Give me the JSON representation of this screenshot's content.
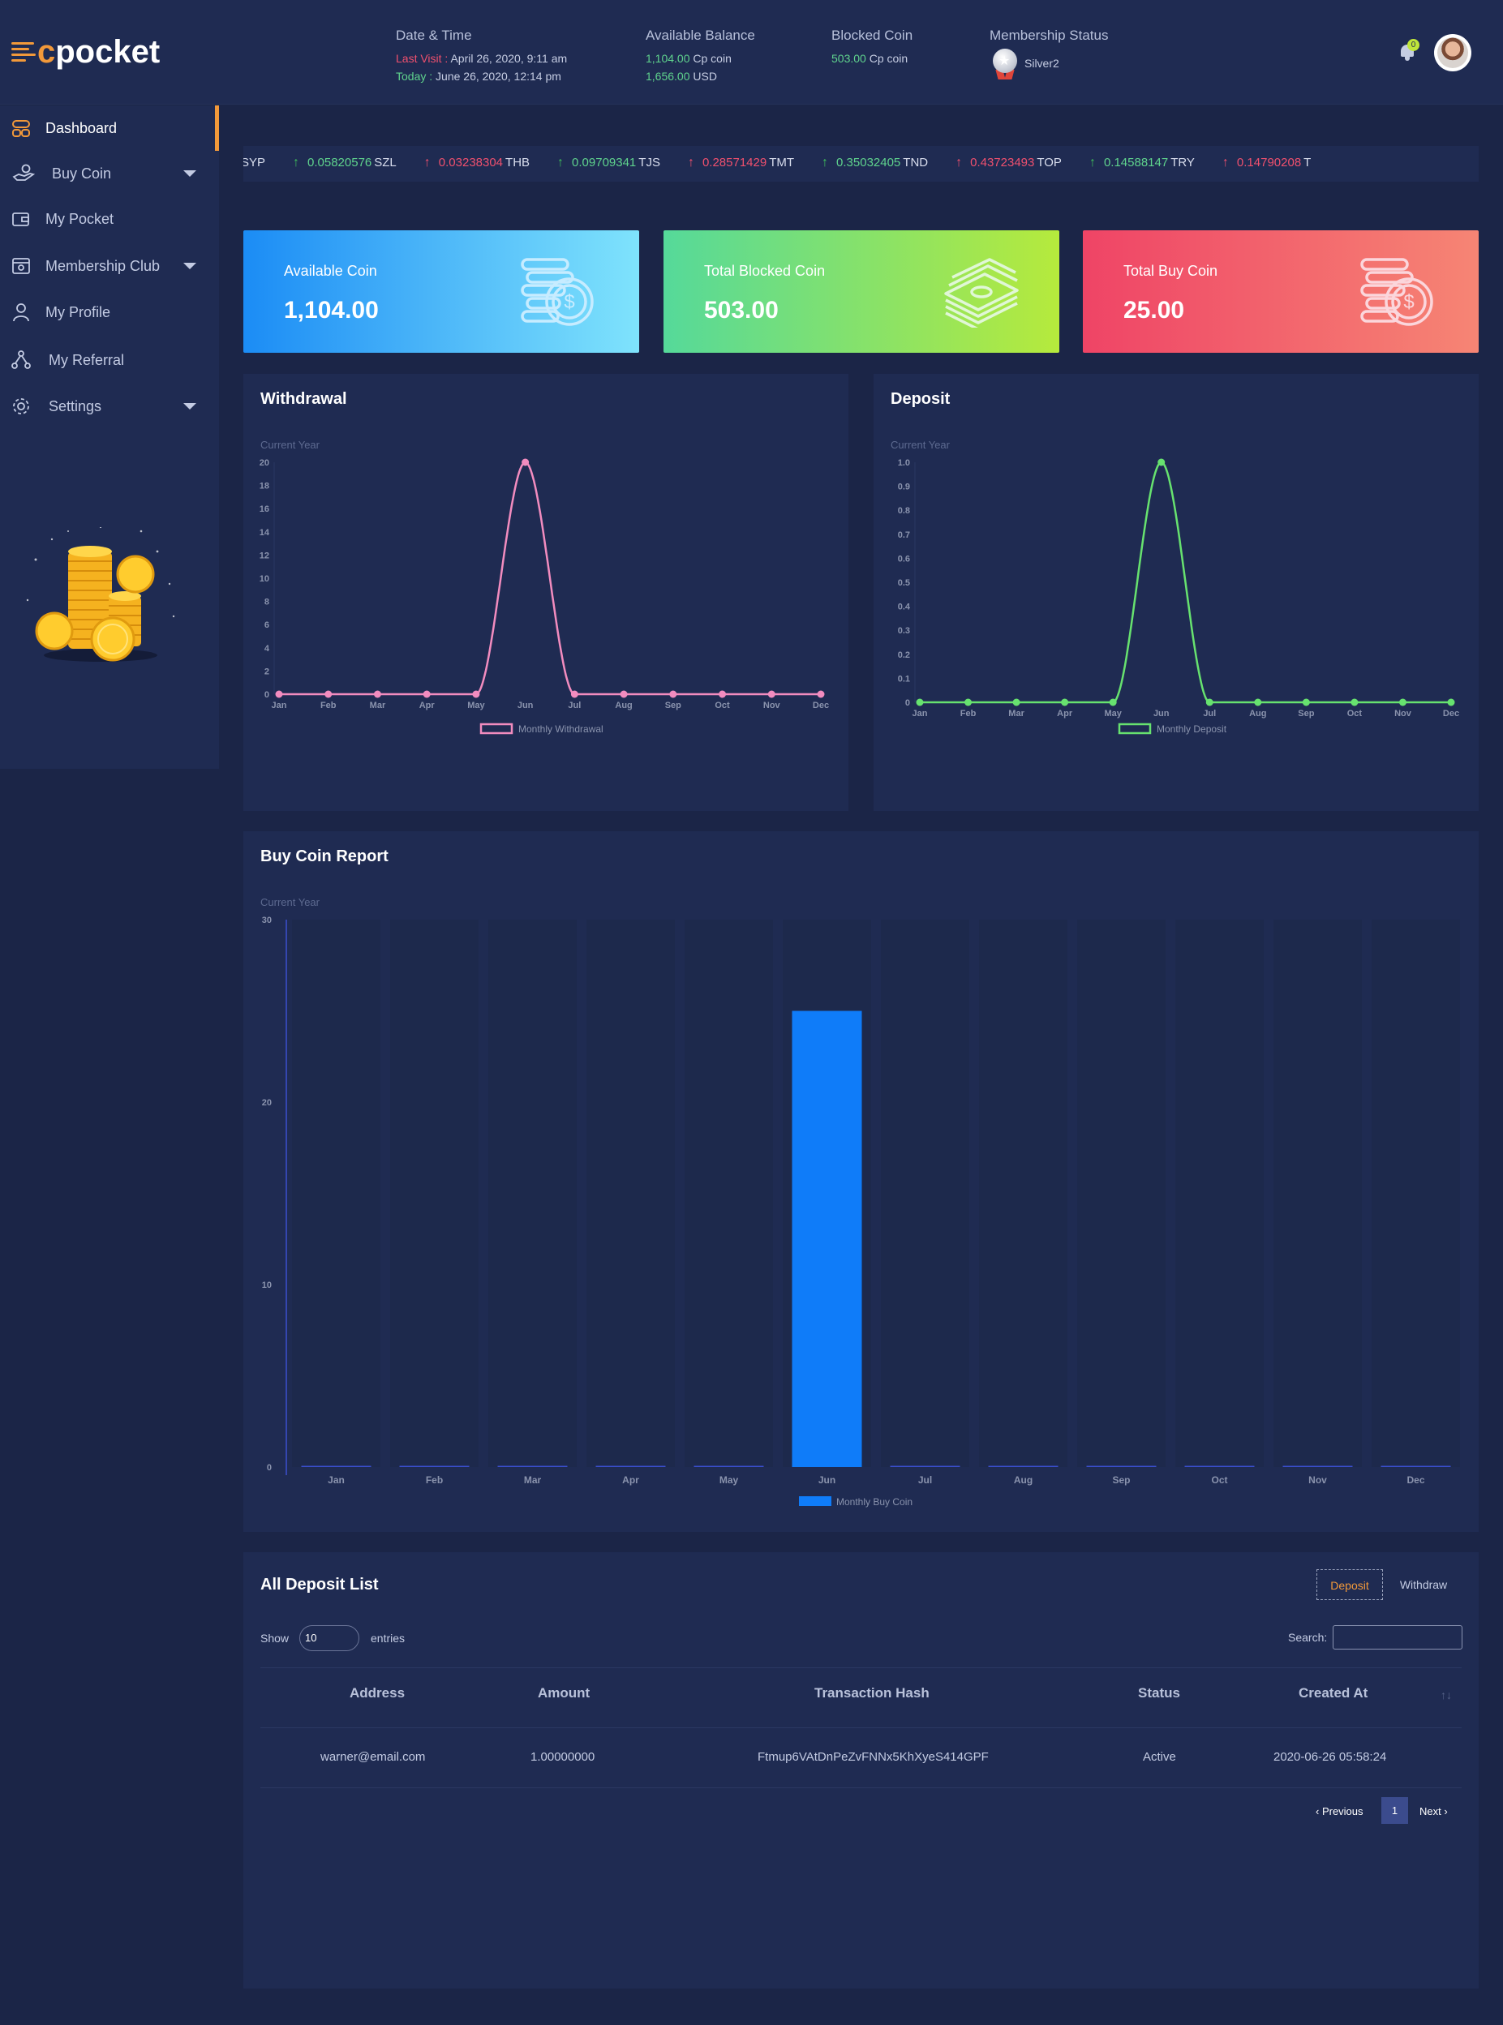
{
  "brand": {
    "logo_c": "c",
    "logo_word": "pocket"
  },
  "header": {
    "datetime_label": "Date & Time",
    "last_visit_label": "Last Visit :",
    "last_visit_value": "April 26, 2020, 9:11 am",
    "today_label": "Today :",
    "today_value": "June 26, 2020, 12:14 pm",
    "balance_label": "Available Balance",
    "balance_coin_value": "1,104.00",
    "balance_coin_unit": "Cp coin",
    "balance_usd_value": "1,656.00",
    "balance_usd_unit": "USD",
    "blocked_label": "Blocked Coin",
    "blocked_value": "503.00",
    "blocked_unit": "Cp coin",
    "membership_label": "Membership Status",
    "membership_value": "Silver2",
    "notification_count": "0"
  },
  "sidebar": {
    "items": [
      {
        "label": "Dashboard",
        "icon": "dashboard-icon"
      },
      {
        "label": "Buy Coin",
        "icon": "hand-coin-icon"
      },
      {
        "label": "My Pocket",
        "icon": "wallet-icon"
      },
      {
        "label": "Membership Club",
        "icon": "membership-card-icon"
      },
      {
        "label": "My Profile",
        "icon": "user-icon"
      },
      {
        "label": "My Referral",
        "icon": "share-network-icon"
      },
      {
        "label": "Settings",
        "icon": "gear-icon"
      }
    ]
  },
  "ticker": [
    {
      "dir": "",
      "value": "",
      "cur": "SYP"
    },
    {
      "dir": "up",
      "value": "0.05820576",
      "cur": "SZL"
    },
    {
      "dir": "up-red",
      "value": "0.03238304",
      "cur": "THB"
    },
    {
      "dir": "up",
      "value": "0.09709341",
      "cur": "TJS"
    },
    {
      "dir": "up-red",
      "value": "0.28571429",
      "cur": "TMT"
    },
    {
      "dir": "up",
      "value": "0.35032405",
      "cur": "TND"
    },
    {
      "dir": "up-red",
      "value": "0.43723493",
      "cur": "TOP"
    },
    {
      "dir": "up",
      "value": "0.14588147",
      "cur": "TRY"
    },
    {
      "dir": "up-red",
      "value": "0.14790208",
      "cur": "T"
    }
  ],
  "cards": [
    {
      "title": "Available Coin",
      "value": "1,104.00",
      "icon": "coins-dollar-icon"
    },
    {
      "title": "Total Blocked Coin",
      "value": "503.00",
      "icon": "cash-stack-icon"
    },
    {
      "title": "Total Buy Coin",
      "value": "25.00",
      "icon": "coins-dollar-icon"
    }
  ],
  "withdrawal_panel": {
    "title": "Withdrawal",
    "subtitle": "Current Year"
  },
  "deposit_panel": {
    "title": "Deposit",
    "subtitle": "Current Year"
  },
  "buy_panel": {
    "title": "Buy Coin Report",
    "subtitle": "Current Year"
  },
  "chart_data": [
    {
      "type": "line",
      "x": [
        "Jan",
        "Feb",
        "Mar",
        "Apr",
        "May",
        "Jun",
        "Jul",
        "Aug",
        "Sep",
        "Oct",
        "Nov",
        "Dec"
      ],
      "series": [
        {
          "name": "Monthly Withdrawal",
          "values": [
            0,
            0,
            0,
            0,
            0,
            20,
            0,
            0,
            0,
            0,
            0,
            0
          ],
          "color": "#f28cbf"
        }
      ],
      "yticks": [
        "0",
        "2",
        "4",
        "6",
        "8",
        "10",
        "12",
        "14",
        "16",
        "18",
        "20"
      ],
      "ylim": [
        0,
        20
      ],
      "legend": "bottom",
      "grid": false
    },
    {
      "type": "line",
      "x": [
        "Jan",
        "Feb",
        "Mar",
        "Apr",
        "May",
        "Jun",
        "Jul",
        "Aug",
        "Sep",
        "Oct",
        "Nov",
        "Dec"
      ],
      "series": [
        {
          "name": "Monthly Deposit",
          "values": [
            0,
            0,
            0,
            0,
            0,
            1,
            0,
            0,
            0,
            0,
            0,
            0
          ],
          "color": "#67e26f"
        }
      ],
      "yticks": [
        "0",
        "0.1",
        "0.2",
        "0.3",
        "0.4",
        "0.5",
        "0.6",
        "0.7",
        "0.8",
        "0.9",
        "1.0"
      ],
      "ylim": [
        0,
        1
      ],
      "legend": "bottom",
      "grid": false
    },
    {
      "type": "bar",
      "categories": [
        "Jan",
        "Feb",
        "Mar",
        "Apr",
        "May",
        "Jun",
        "Jul",
        "Aug",
        "Sep",
        "Oct",
        "Nov",
        "Dec"
      ],
      "series": [
        {
          "name": "Monthly Buy Coin",
          "values": [
            0,
            0,
            0,
            0,
            0,
            25,
            0,
            0,
            0,
            0,
            0,
            0
          ],
          "color": "#0f7cf9"
        }
      ],
      "yticks": [
        "0",
        "10",
        "20",
        "30"
      ],
      "ylim": [
        0,
        30
      ],
      "legend": "bottom",
      "grid": false
    }
  ],
  "deposit_list": {
    "title": "All Deposit List",
    "tab_deposit": "Deposit",
    "tab_withdraw": "Withdraw",
    "show_label": "Show",
    "entries_value": "10",
    "entries_label": "entries",
    "search_label": "Search:",
    "columns": [
      "Address",
      "Amount",
      "Transaction Hash",
      "Status",
      "Created At"
    ],
    "sort_glyph": "↑↓",
    "rows": [
      {
        "address": "warner@email.com",
        "amount": "1.00000000",
        "hash": "Ftmup6VAtDnPeZvFNNx5KhXyeS414GPF",
        "status": "Active",
        "created": "2020-06-26 05:58:24"
      }
    ],
    "prev": "‹ Previous",
    "page": "1",
    "next": "Next ›"
  },
  "colors": {
    "bg": "#1b2547",
    "panel": "#1f2b52",
    "accent": "#f2993a",
    "green": "#5fd38d",
    "red": "#f0506e"
  }
}
